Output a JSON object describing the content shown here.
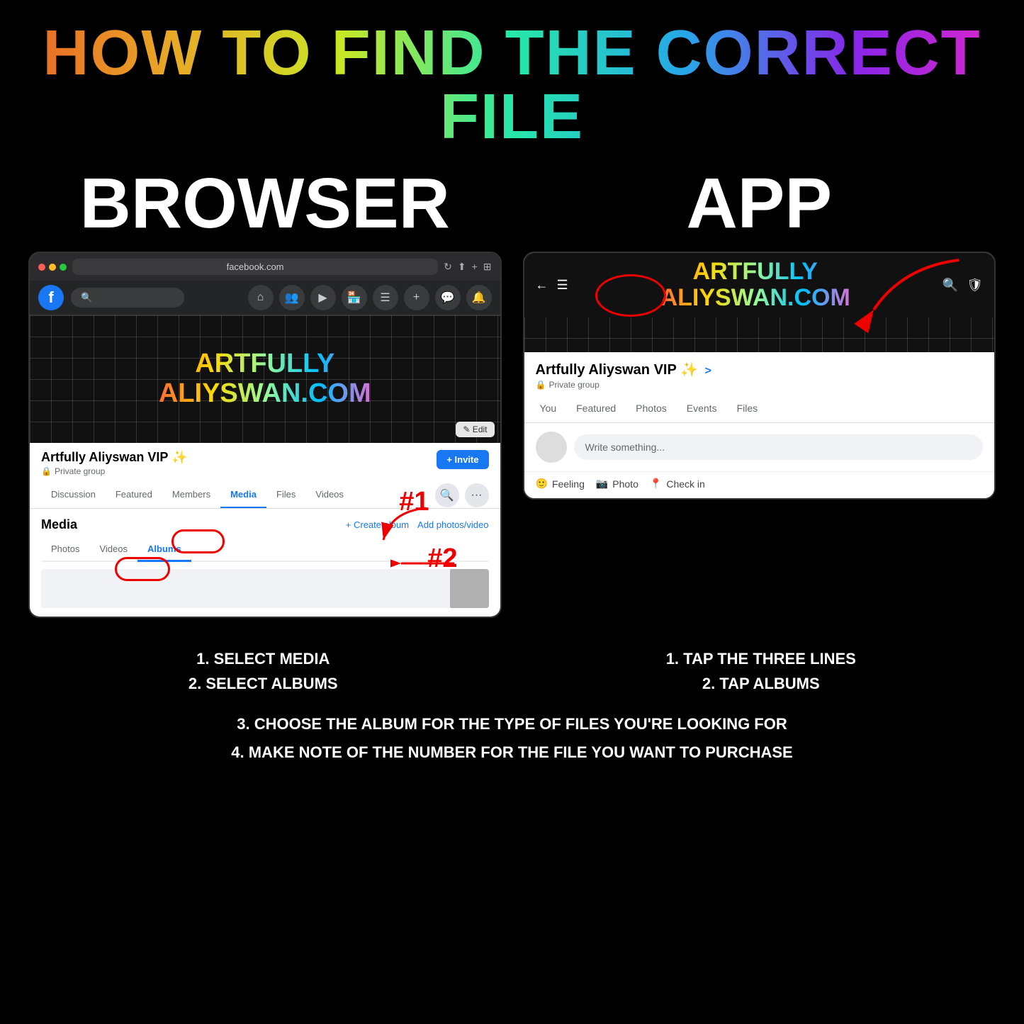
{
  "title": "HOW TO FIND THE CORRECT FILE",
  "browser_label": "BROWSER",
  "app_label": "APP",
  "browser_url": "facebook.com",
  "fb_group_name": "Artfully Aliyswan VIP ✨",
  "fb_group_private": "Private group",
  "artfully_line1": "ARTFULLY",
  "artfully_line2": "ALIYSWAN.COM",
  "edit_button": "✎ Edit",
  "fb_tabs": [
    "Discussion",
    "Featured",
    "Members",
    "Media",
    "Files",
    "Videos"
  ],
  "fb_active_tab": "Media",
  "invite_btn": "+ Invite",
  "media_title": "Media",
  "create_album": "+ Create album",
  "add_photos": "Add photos/video",
  "media_tabs": [
    "Photos",
    "Videos",
    "Albums"
  ],
  "active_media_tab": "Albums",
  "annotation_1": "#1",
  "annotation_2": "#2",
  "app_group_name": "Artfully Aliyswan VIP ✨",
  "app_group_name_suffix": ">",
  "app_group_private": "Private group",
  "app_tabs": [
    "You",
    "Featured",
    "Photos",
    "Events",
    "Files"
  ],
  "app_write_placeholder": "Write something...",
  "action_feeling": "Feeling",
  "action_photo": "Photo",
  "action_checkin": "Check in",
  "bottom_left": [
    "1. SELECT MEDIA",
    "2. SELECT ALBUMS"
  ],
  "bottom_right": [
    "1. TAP THE THREE LINES",
    "2. TAP ALBUMS"
  ],
  "bottom_full_1": "3. CHOOSE THE ALBUM FOR THE TYPE OF FILES YOU'RE LOOKING FOR",
  "bottom_full_2": "4. MAKE NOTE OF THE NUMBER FOR THE FILE YOU WANT TO PURCHASE"
}
